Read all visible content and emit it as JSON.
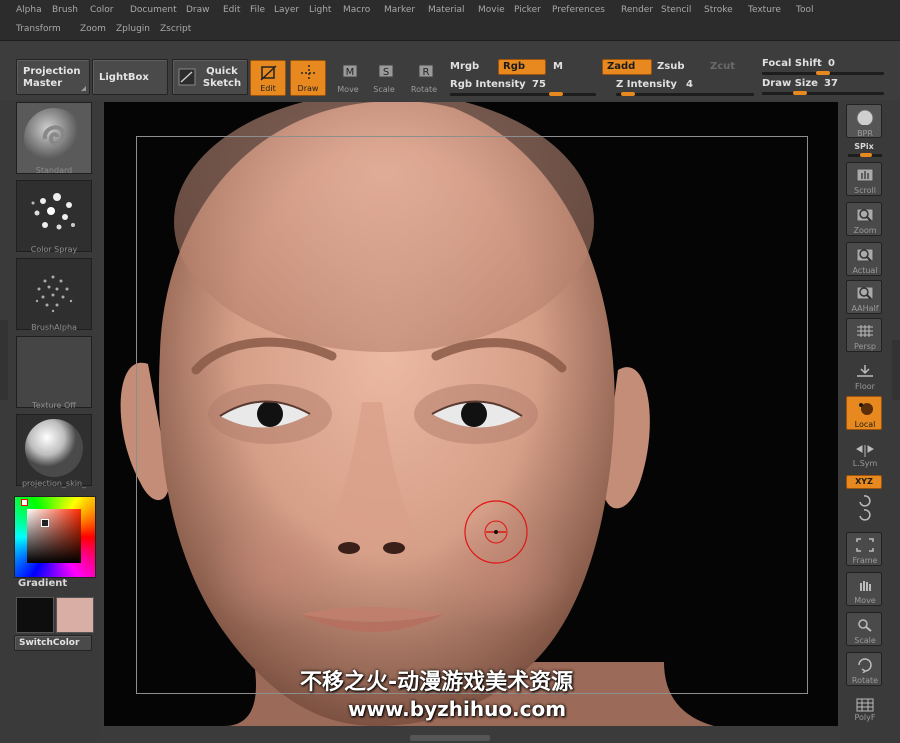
{
  "menu": [
    "Alpha",
    "Brush",
    "Color",
    "Document",
    "Draw",
    "Edit",
    "File",
    "Layer",
    "Light",
    "Macro",
    "Marker",
    "Material",
    "Movie",
    "Picker",
    "Preferences",
    "Render",
    "Stencil",
    "Stroke",
    "Texture",
    "Tool",
    "Transform",
    "Zoom",
    "Zplugin",
    "Zscript"
  ],
  "shelf": {
    "projection_master": "Projection Master",
    "lightbox": "LightBox",
    "quick_sketch": "Quick Sketch",
    "tools": {
      "edit": "Edit",
      "draw": "Draw",
      "move": "Move",
      "scale": "Scale",
      "rotate": "Rotate"
    },
    "tool_icon_letters": {
      "move": "M",
      "scale": "S",
      "rotate": "R"
    },
    "mrgb": "Mrgb",
    "rgb": "Rgb",
    "m": "M",
    "rgb_intensity_label": "Rgb Intensity",
    "rgb_intensity": 75,
    "zadd": "Zadd",
    "zsub": "Zsub",
    "zcut": "Zcut",
    "z_intensity_label": "Z Intensity",
    "z_intensity": 4,
    "focal_shift_label": "Focal Shift",
    "focal_shift": 0,
    "draw_size_label": "Draw Size",
    "draw_size": 37
  },
  "left_tray": {
    "brush_caption": "Standard",
    "stroke_caption": "Color Spray",
    "alpha_caption": "BrushAlpha",
    "texture_caption": "Texture Off",
    "material_caption": "projection_skin_",
    "gradient_label": "Gradient",
    "switch_color_label": "SwitchColor",
    "main_color": "#0e0e0e",
    "secondary_color": "#d9aea4"
  },
  "right_tray": {
    "bpr": "BPR",
    "spix_label": "SPix",
    "buttons": [
      "Scroll",
      "Zoom",
      "Actual",
      "AAHalf",
      "Persp",
      "Floor",
      "Local",
      "L.Sym",
      "XYZ",
      "Frame",
      "Move",
      "Scale",
      "Rotate",
      "PolyF"
    ]
  },
  "watermark": {
    "line1": "不移之火-动漫游戏美术资源",
    "line2": "www.byzhihuo.com"
  },
  "colors": {
    "accent": "#e8891f",
    "panel": "#3b3b3b",
    "canvas": "#050505",
    "skin": "#d29a84"
  }
}
